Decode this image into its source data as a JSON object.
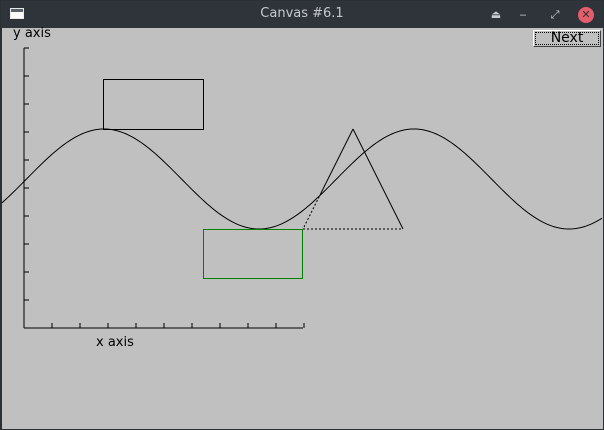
{
  "window": {
    "title": "Canvas #6.1",
    "title_icons": [
      "window-icon",
      "shade-icon",
      "minimize-icon",
      "maximize-icon",
      "close-icon"
    ]
  },
  "canvas": {
    "next_button_label": "Next",
    "y_axis_label": "y axis",
    "x_axis_label": "x axis",
    "colors": {
      "background": "#c0c0c0",
      "lines": "#000000",
      "green_rectangle": "#008000",
      "close_button": "#e35d6a"
    }
  }
}
